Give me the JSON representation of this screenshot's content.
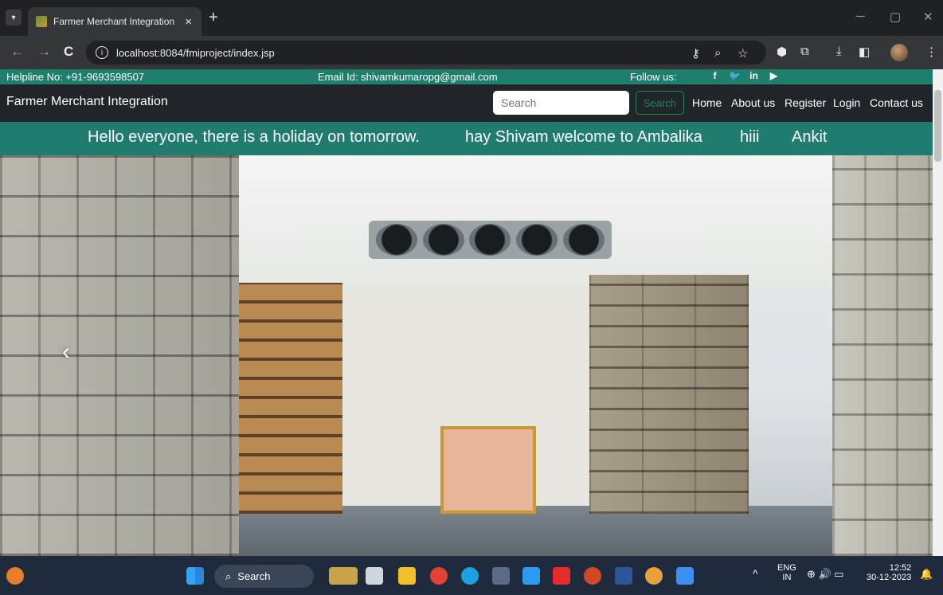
{
  "browser": {
    "tab_title": "Farmer Merchant Integration",
    "tab_close": "×",
    "new_tab": "+",
    "url": "localhost:8084/fmiproject/index.jsp",
    "back": "←",
    "forward": "→",
    "reload": "C",
    "minimize": "─",
    "restore": "▢",
    "close": "✕"
  },
  "topbar": {
    "helpline": "Helpline No: +91-9693598507",
    "email": "Email Id: shivamkumaropg@gmail.com",
    "follow": "Follow us:"
  },
  "navbar": {
    "brand": "Farmer Merchant Integration",
    "search_placeholder": "Search",
    "search_button": "Search",
    "links": [
      "Home",
      "About us",
      "Register",
      "Login",
      "Contact us"
    ]
  },
  "marquee": {
    "items": [
      "Hello everyone, there is a holiday on tomorrow.",
      "hay Shivam welcome to Ambalika",
      "hiii",
      "Ankit"
    ]
  },
  "carousel": {
    "prev": "‹"
  },
  "taskbar": {
    "search": "Search",
    "lang_top": "ENG",
    "lang_bottom": "IN",
    "time": "12:52",
    "date": "30-12-2023",
    "chevron": "^"
  }
}
